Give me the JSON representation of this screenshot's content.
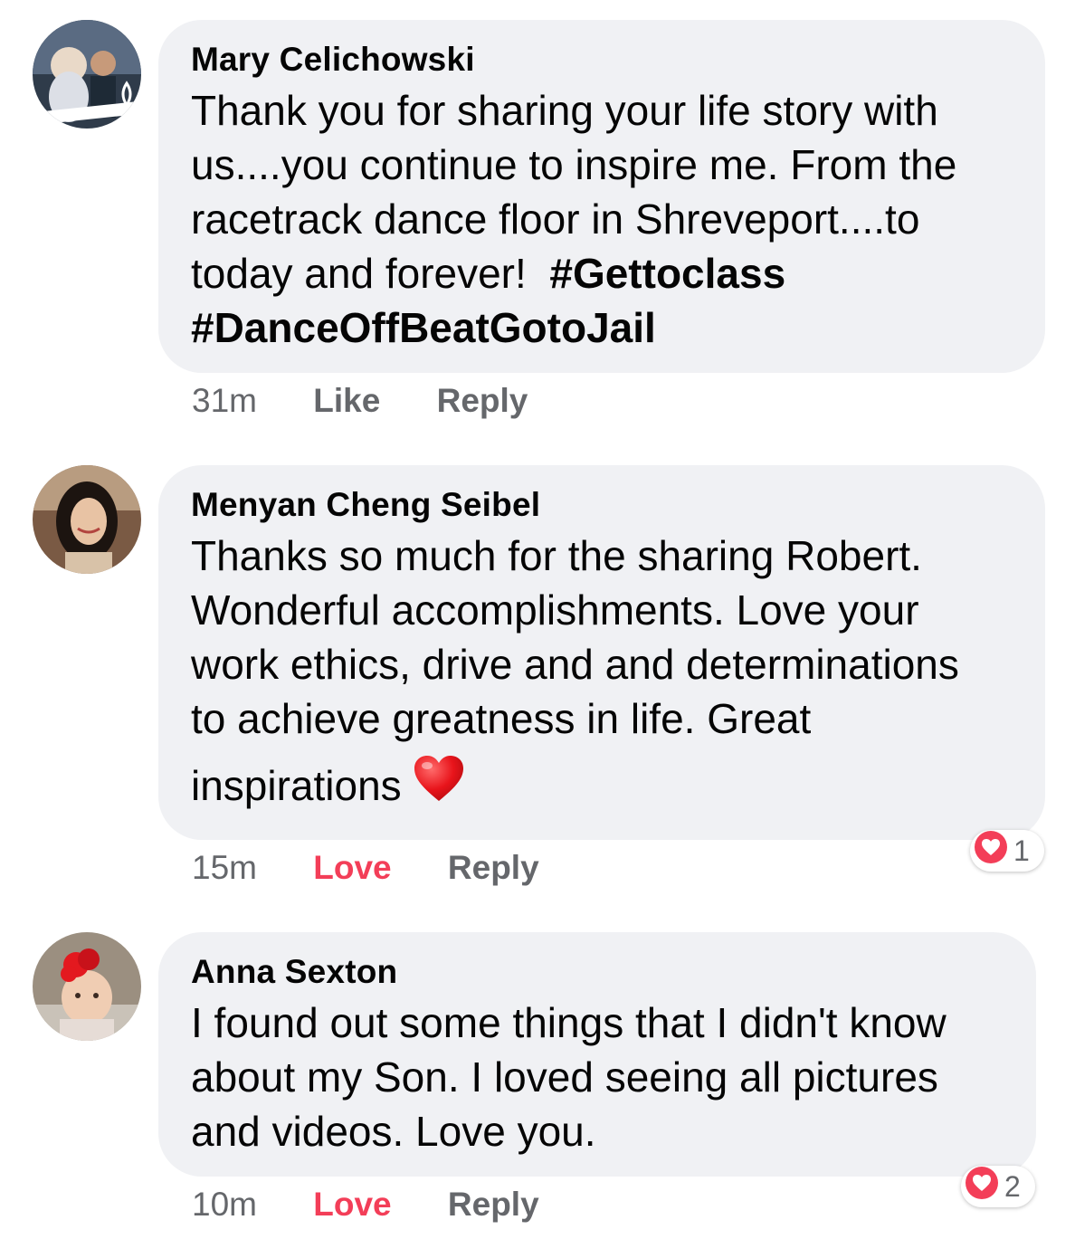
{
  "comments": [
    {
      "author": "Mary Celichowski",
      "lines": [
        "Thank you for sharing your life story with",
        "us....you continue to inspire me.  From the",
        "racetrack dance floor in Shreveport....to",
        "today and forever!  "
      ],
      "hashtags": [
        "#Gettoclass",
        "#DanceOffBeatGotoJail"
      ],
      "time": "31m",
      "like_label": "Like",
      "reply_label": "Reply"
    },
    {
      "author": "Menyan Cheng Seibel",
      "lines": [
        "Thanks so much for the sharing Robert.",
        "Wonderful accomplishments.  Love your",
        "work ethics, drive and and determinations",
        "to achieve greatness in life.  Great",
        "inspirations"
      ],
      "emoji": "red-heart",
      "time": "15m",
      "like_label": "Love",
      "reply_label": "Reply",
      "reaction_count": "1"
    },
    {
      "author": "Anna Sexton",
      "lines": [
        "I found out some things that I didn't know",
        "about my Son. I loved seeing all pictures",
        "and videos. Love you."
      ],
      "time": "10m",
      "like_label": "Love",
      "reply_label": "Reply",
      "reaction_count": "2"
    }
  ],
  "colors": {
    "bubble": "#f0f1f4",
    "text": "#050505",
    "meta": "#65676b",
    "love": "#f33e58"
  }
}
